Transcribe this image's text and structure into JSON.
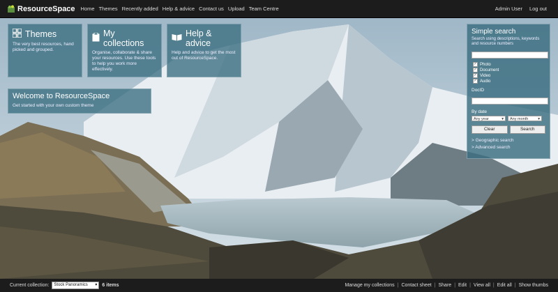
{
  "header": {
    "logo_text": "ResourceSpace",
    "nav": [
      "Home",
      "Themes",
      "Recently added",
      "Help & advice",
      "Contact us",
      "Upload",
      "Team Centre"
    ],
    "user": [
      "Admin User",
      "Log out"
    ]
  },
  "tiles": {
    "themes": {
      "title": "Themes",
      "text": "The very best resources, hand picked and grouped."
    },
    "collections": {
      "title": "My collections",
      "text": "Organise, collaborate & share your resources. Use these tools to help you work more effectively."
    },
    "help": {
      "title": "Help & advice",
      "text": "Help and advice to get the most out of ResourceSpace."
    },
    "welcome": {
      "title": "Welcome to ResourceSpace",
      "text": "Get started with your own custom theme"
    }
  },
  "search": {
    "title": "Simple search",
    "description": "Search using descriptions, keywords and resource numbers",
    "types": [
      "Photo",
      "Document",
      "Video",
      "Audio"
    ],
    "docid_label": "DocID",
    "bydate_label": "By date",
    "year": "Any year",
    "month": "Any month",
    "clear": "Clear",
    "search": "Search",
    "geo": "> Geographic search",
    "advanced": "> Advanced search"
  },
  "footer": {
    "current_label": "Current collection:",
    "collection": "Stock Panoramics",
    "items": "6 items",
    "links": [
      "Manage my collections",
      "Contact sheet",
      "Share",
      "Edit",
      "View all",
      "Edit all",
      "Show thumbs"
    ]
  }
}
